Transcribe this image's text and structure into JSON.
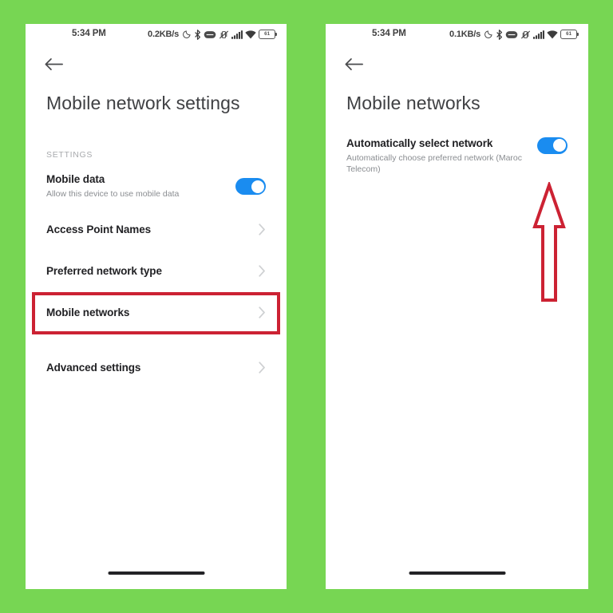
{
  "theme": {
    "background": "#77d653",
    "panel": "#ffffff",
    "accent_toggle": "#1a8cf0",
    "highlight": "#cc2233",
    "title_color": "#3f4043",
    "label_color": "#a8aaad"
  },
  "phones": [
    {
      "id": "left",
      "status_bar": {
        "time": "5:34 PM",
        "network_speed": "0.2KB/s",
        "icons": [
          "dnd-moon-icon",
          "bluetooth-icon",
          "data-saver-icon",
          "vibrate-off-icon",
          "signal-bars-icon",
          "wifi-icon"
        ],
        "battery_level": "61"
      },
      "app_bar": {
        "back_icon": "back-arrow-icon"
      },
      "title": "Mobile network settings",
      "section_label": "SETTINGS",
      "toggle_row": {
        "title": "Mobile data",
        "subtitle": "Allow this device to use mobile data",
        "toggle_on": true
      },
      "links": [
        {
          "label": "Access Point Names",
          "chevron": "chevron-right-icon",
          "highlighted": false
        },
        {
          "label": "Preferred network type",
          "chevron": "chevron-right-icon",
          "highlighted": false
        },
        {
          "label": "Mobile networks",
          "chevron": "chevron-right-icon",
          "highlighted": true
        }
      ],
      "advanced": {
        "label": "Advanced settings",
        "chevron": "chevron-right-icon"
      }
    },
    {
      "id": "right",
      "status_bar": {
        "time": "5:34 PM",
        "network_speed": "0.1KB/s",
        "icons": [
          "dnd-moon-icon",
          "bluetooth-icon",
          "data-saver-icon",
          "vibrate-off-icon",
          "signal-bars-icon",
          "wifi-icon"
        ],
        "battery_level": "61"
      },
      "app_bar": {
        "back_icon": "back-arrow-icon"
      },
      "title": "Mobile networks",
      "toggle_row": {
        "title": "Automatically select network",
        "subtitle": "Automatically choose preferred network (Maroc Telecom)",
        "toggle_on": true
      },
      "annotation": {
        "type": "up-arrow-annotation",
        "color": "#cc2233",
        "points_at": "automatically-select-network-toggle"
      }
    }
  ]
}
